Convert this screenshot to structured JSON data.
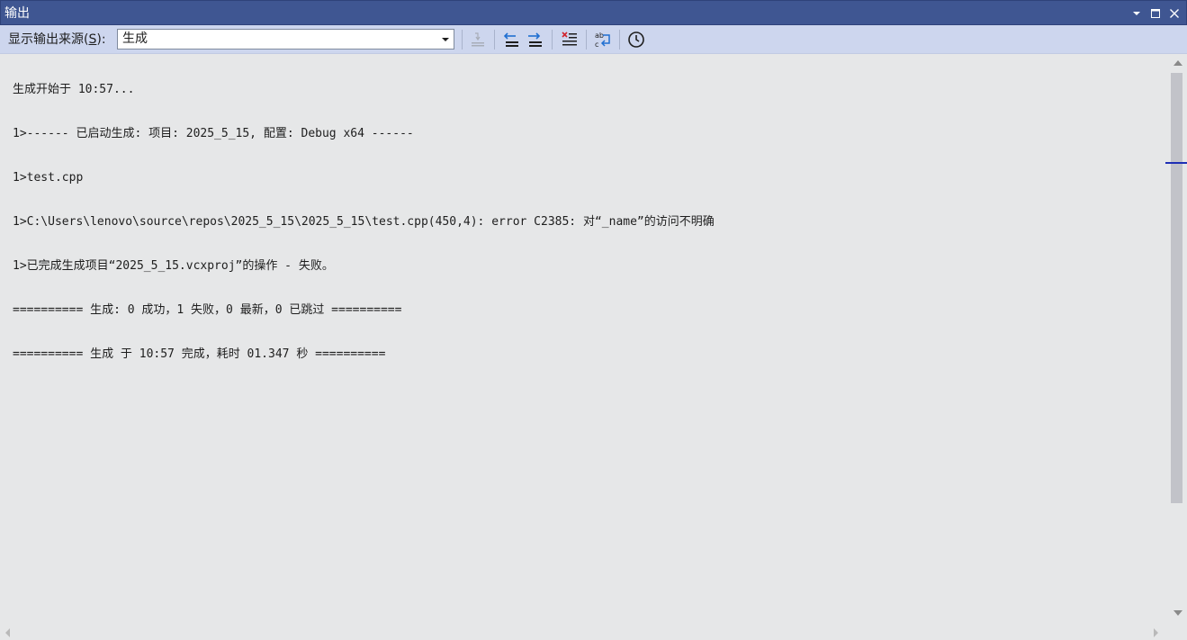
{
  "window": {
    "title": "输出"
  },
  "toolbar": {
    "source_label_prefix": "显示输出来源(",
    "source_label_key": "S",
    "source_label_suffix": "):",
    "source_selected": "生成"
  },
  "output": {
    "lines": [
      "生成开始于 10:57...",
      "1>------ 已启动生成: 项目: 2025_5_15, 配置: Debug x64 ------",
      "1>test.cpp",
      "1>C:\\Users\\lenovo\\source\\repos\\2025_5_15\\2025_5_15\\test.cpp(450,4): error C2385: 对“_name”的访问不明确",
      "1>已完成生成项目“2025_5_15.vcxproj”的操作 - 失败。",
      "========== 生成: 0 成功，1 失败，0 最新，0 已跳过 ==========",
      "========== 生成 于 10:57 完成，耗时 01.347 秒 =========="
    ]
  },
  "icons": {
    "window_position": "dropdown-arrow-icon",
    "maximize": "maximize-icon",
    "close": "close-icon",
    "find_message": "find-message-icon",
    "prev_message": "go-to-previous-message-icon",
    "next_message": "go-to-next-message-icon",
    "clear_all": "clear-all-icon",
    "word_wrap": "toggle-word-wrap-icon",
    "timestamp": "show-timestamp-icon"
  },
  "colors": {
    "titlebar": "#3f5692",
    "toolbar": "#cdd6ee",
    "pane": "#e6e7e8",
    "text": "#1e1e1e",
    "accent": "#1f6fd1"
  }
}
